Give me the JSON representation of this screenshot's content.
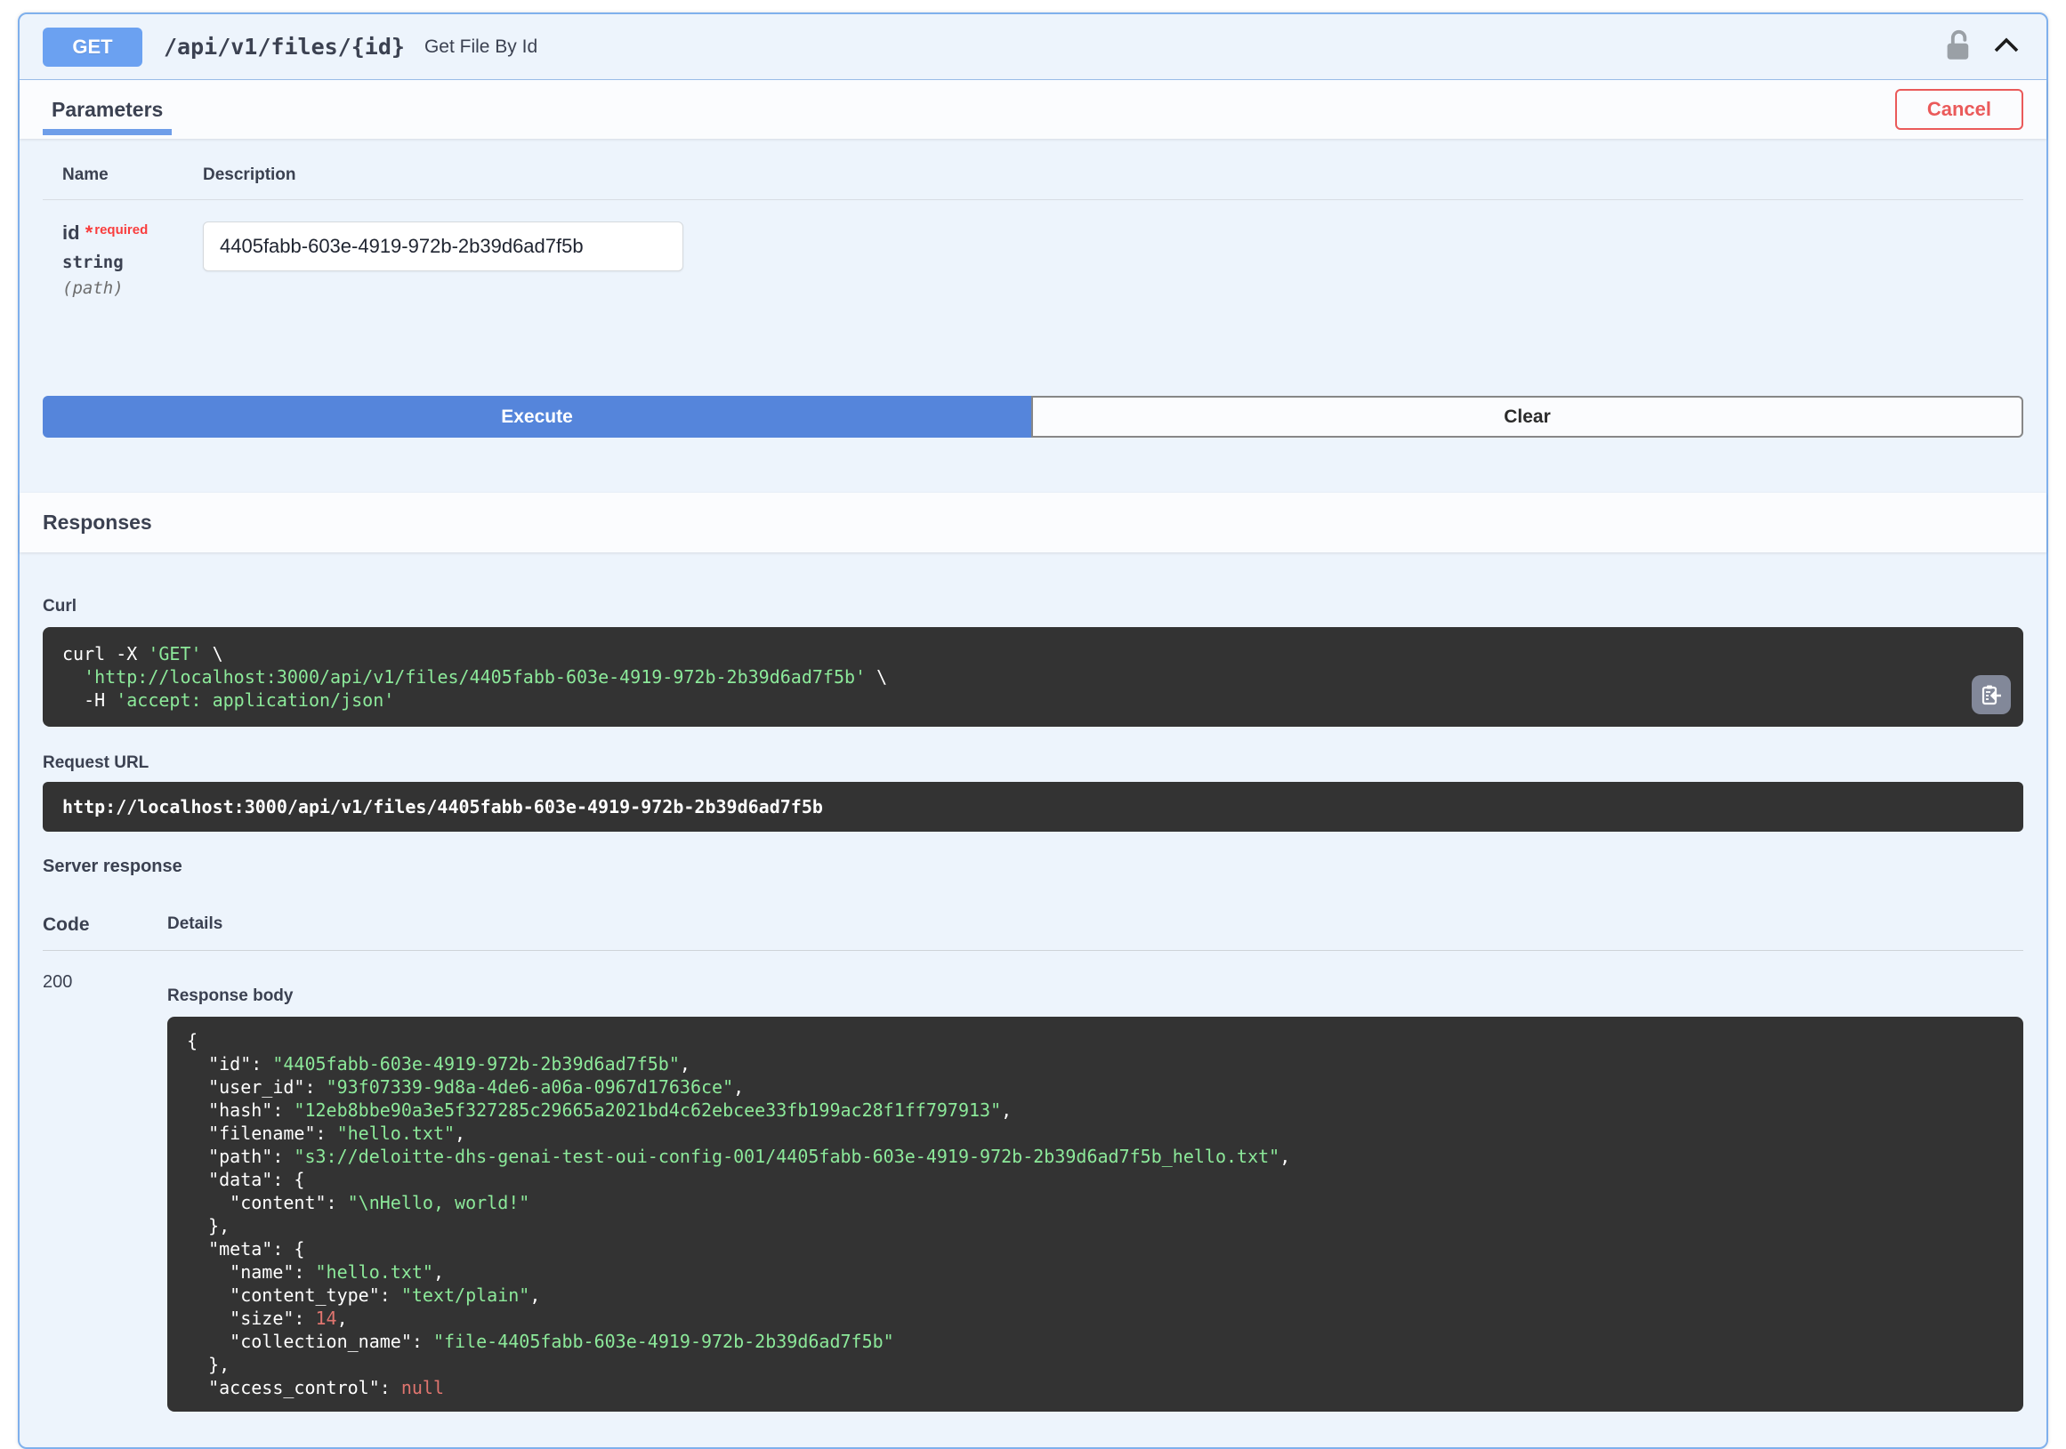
{
  "endpoint": {
    "method": "GET",
    "path": "/api/v1/files/{id}",
    "summary": "Get File By Id"
  },
  "tabs": {
    "parameters_label": "Parameters",
    "cancel_label": "Cancel"
  },
  "parameters": {
    "name_header": "Name",
    "description_header": "Description",
    "row": {
      "name": "id",
      "required_star": "*",
      "required_label": "required",
      "type": "string",
      "location": "(path)",
      "value": "4405fabb-603e-4919-972b-2b39d6ad7f5b"
    }
  },
  "actions": {
    "execute_label": "Execute",
    "clear_label": "Clear"
  },
  "responses": {
    "title": "Responses",
    "curl_label": "Curl",
    "request_url_label": "Request URL",
    "request_url": "http://localhost:3000/api/v1/files/4405fabb-603e-4919-972b-2b39d6ad7f5b",
    "server_response_label": "Server response",
    "code_header": "Code",
    "details_header": "Details",
    "status_code": "200",
    "response_body_label": "Response body"
  },
  "curl_lines": [
    [
      {
        "t": "curl -X ",
        "c": "w"
      },
      {
        "t": "'GET'",
        "c": "g"
      },
      {
        "t": " \\",
        "c": "w"
      }
    ],
    [
      {
        "t": "  ",
        "c": "w"
      },
      {
        "t": "'http://localhost:3000/api/v1/files/4405fabb-603e-4919-972b-2b39d6ad7f5b'",
        "c": "g"
      },
      {
        "t": " \\",
        "c": "w"
      }
    ],
    [
      {
        "t": "  -H ",
        "c": "w"
      },
      {
        "t": "'accept: application/json'",
        "c": "g"
      }
    ]
  ],
  "response_body_lines": [
    [
      {
        "t": "{",
        "c": "w"
      }
    ],
    [
      {
        "t": "  \"id\": ",
        "c": "w"
      },
      {
        "t": "\"4405fabb-603e-4919-972b-2b39d6ad7f5b\"",
        "c": "g"
      },
      {
        "t": ",",
        "c": "w"
      }
    ],
    [
      {
        "t": "  \"user_id\": ",
        "c": "w"
      },
      {
        "t": "\"93f07339-9d8a-4de6-a06a-0967d17636ce\"",
        "c": "g"
      },
      {
        "t": ",",
        "c": "w"
      }
    ],
    [
      {
        "t": "  \"hash\": ",
        "c": "w"
      },
      {
        "t": "\"12eb8bbe90a3e5f327285c29665a2021bd4c62ebcee33fb199ac28f1ff797913\"",
        "c": "g"
      },
      {
        "t": ",",
        "c": "w"
      }
    ],
    [
      {
        "t": "  \"filename\": ",
        "c": "w"
      },
      {
        "t": "\"hello.txt\"",
        "c": "g"
      },
      {
        "t": ",",
        "c": "w"
      }
    ],
    [
      {
        "t": "  \"path\": ",
        "c": "w"
      },
      {
        "t": "\"s3://deloitte-dhs-genai-test-oui-config-001/4405fabb-603e-4919-972b-2b39d6ad7f5b_hello.txt\"",
        "c": "g"
      },
      {
        "t": ",",
        "c": "w"
      }
    ],
    [
      {
        "t": "  \"data\": {",
        "c": "w"
      }
    ],
    [
      {
        "t": "    \"content\": ",
        "c": "w"
      },
      {
        "t": "\"\\nHello, world!\"",
        "c": "g"
      }
    ],
    [
      {
        "t": "  },",
        "c": "w"
      }
    ],
    [
      {
        "t": "  \"meta\": {",
        "c": "w"
      }
    ],
    [
      {
        "t": "    \"name\": ",
        "c": "w"
      },
      {
        "t": "\"hello.txt\"",
        "c": "g"
      },
      {
        "t": ",",
        "c": "w"
      }
    ],
    [
      {
        "t": "    \"content_type\": ",
        "c": "w"
      },
      {
        "t": "\"text/plain\"",
        "c": "g"
      },
      {
        "t": ",",
        "c": "w"
      }
    ],
    [
      {
        "t": "    \"size\": ",
        "c": "w"
      },
      {
        "t": "14",
        "c": "r"
      },
      {
        "t": ",",
        "c": "w"
      }
    ],
    [
      {
        "t": "    \"collection_name\": ",
        "c": "w"
      },
      {
        "t": "\"file-4405fabb-603e-4919-972b-2b39d6ad7f5b\"",
        "c": "g"
      }
    ],
    [
      {
        "t": "  },",
        "c": "w"
      }
    ],
    [
      {
        "t": "  \"access_control\": ",
        "c": "w"
      },
      {
        "t": "null",
        "c": "r"
      }
    ]
  ],
  "icons": {
    "lock": "unlocked-padlock-icon",
    "collapse": "chevron-up-icon",
    "copy": "copy-to-clipboard-icon"
  },
  "colors": {
    "get_badge": "#6ba1f1",
    "execute_button": "#5585db",
    "cancel_red": "#ea5a5a",
    "container_border": "#7fb0ec",
    "container_bg": "#edf4fc",
    "tab_underline": "#6f9ee9",
    "code_block_bg": "#333333",
    "code_string_green": "#8ce99a",
    "code_number_red": "#e0756f",
    "required_red": "#f93e3e"
  }
}
